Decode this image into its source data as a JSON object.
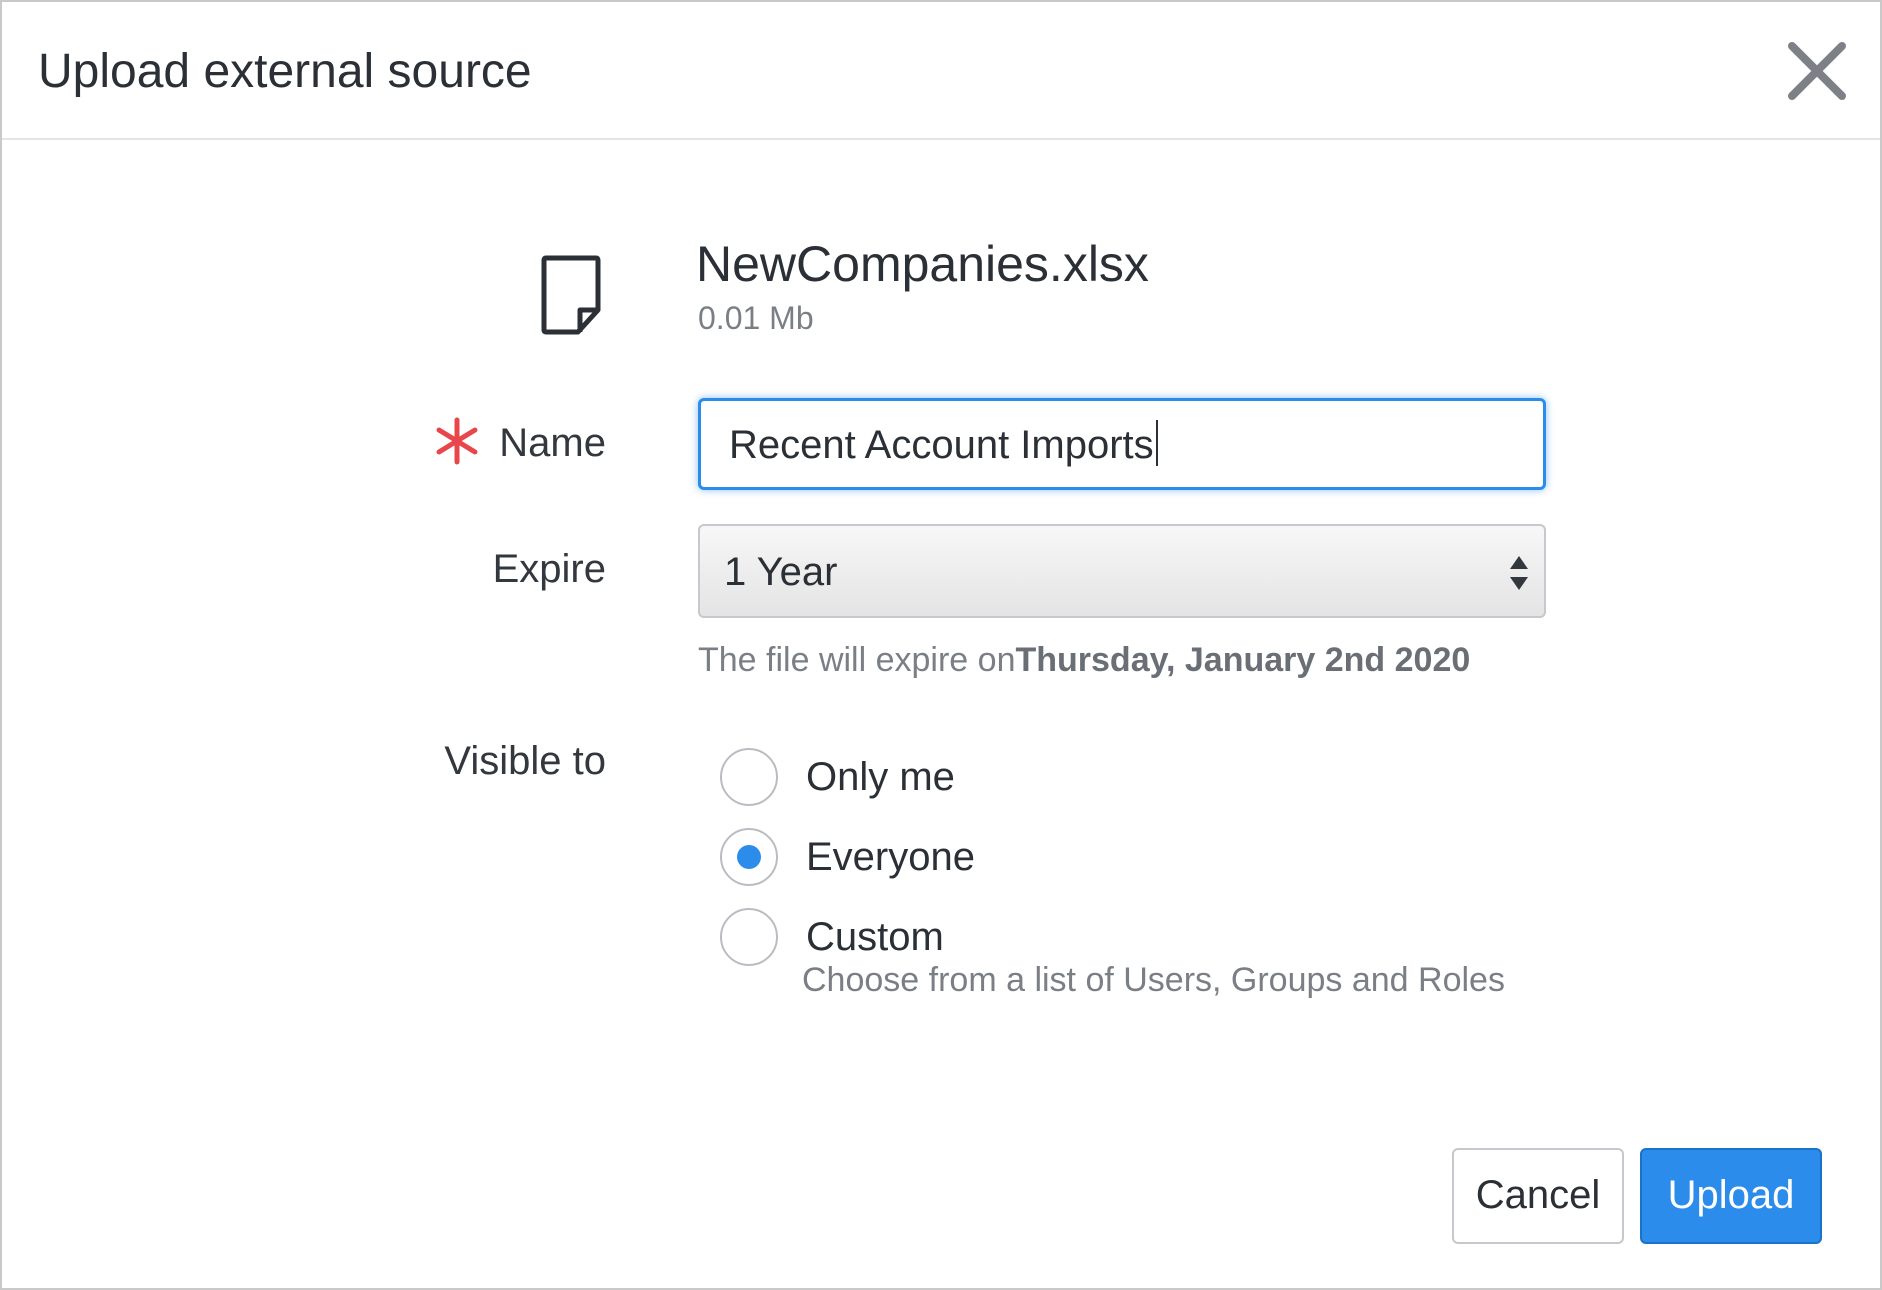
{
  "dialog": {
    "title": "Upload external source",
    "close_icon": "close-icon"
  },
  "file": {
    "icon": "file-icon",
    "name": "NewCompanies.xlsx",
    "size": "0.01 Mb"
  },
  "form": {
    "name_label": "Name",
    "name_required_icon": "asterisk-icon",
    "name_value": "Recent Account Imports",
    "expire_label": "Expire",
    "expire_selected": "1 Year",
    "expire_hint_prefix": "The file will expire on",
    "expire_hint_date": "Thursday, January 2nd 2020",
    "visible_label": "Visible to",
    "visibility_options": [
      {
        "label": "Only me",
        "selected": false
      },
      {
        "label": "Everyone",
        "selected": true
      },
      {
        "label": "Custom",
        "selected": false,
        "description": "Choose from a list of Users, Groups and Roles"
      }
    ]
  },
  "buttons": {
    "cancel": "Cancel",
    "upload": "Upload"
  },
  "colors": {
    "accent": "#2b8ceb",
    "required": "#e8464a",
    "text": "#2b2f36",
    "muted": "#7a7f86"
  }
}
